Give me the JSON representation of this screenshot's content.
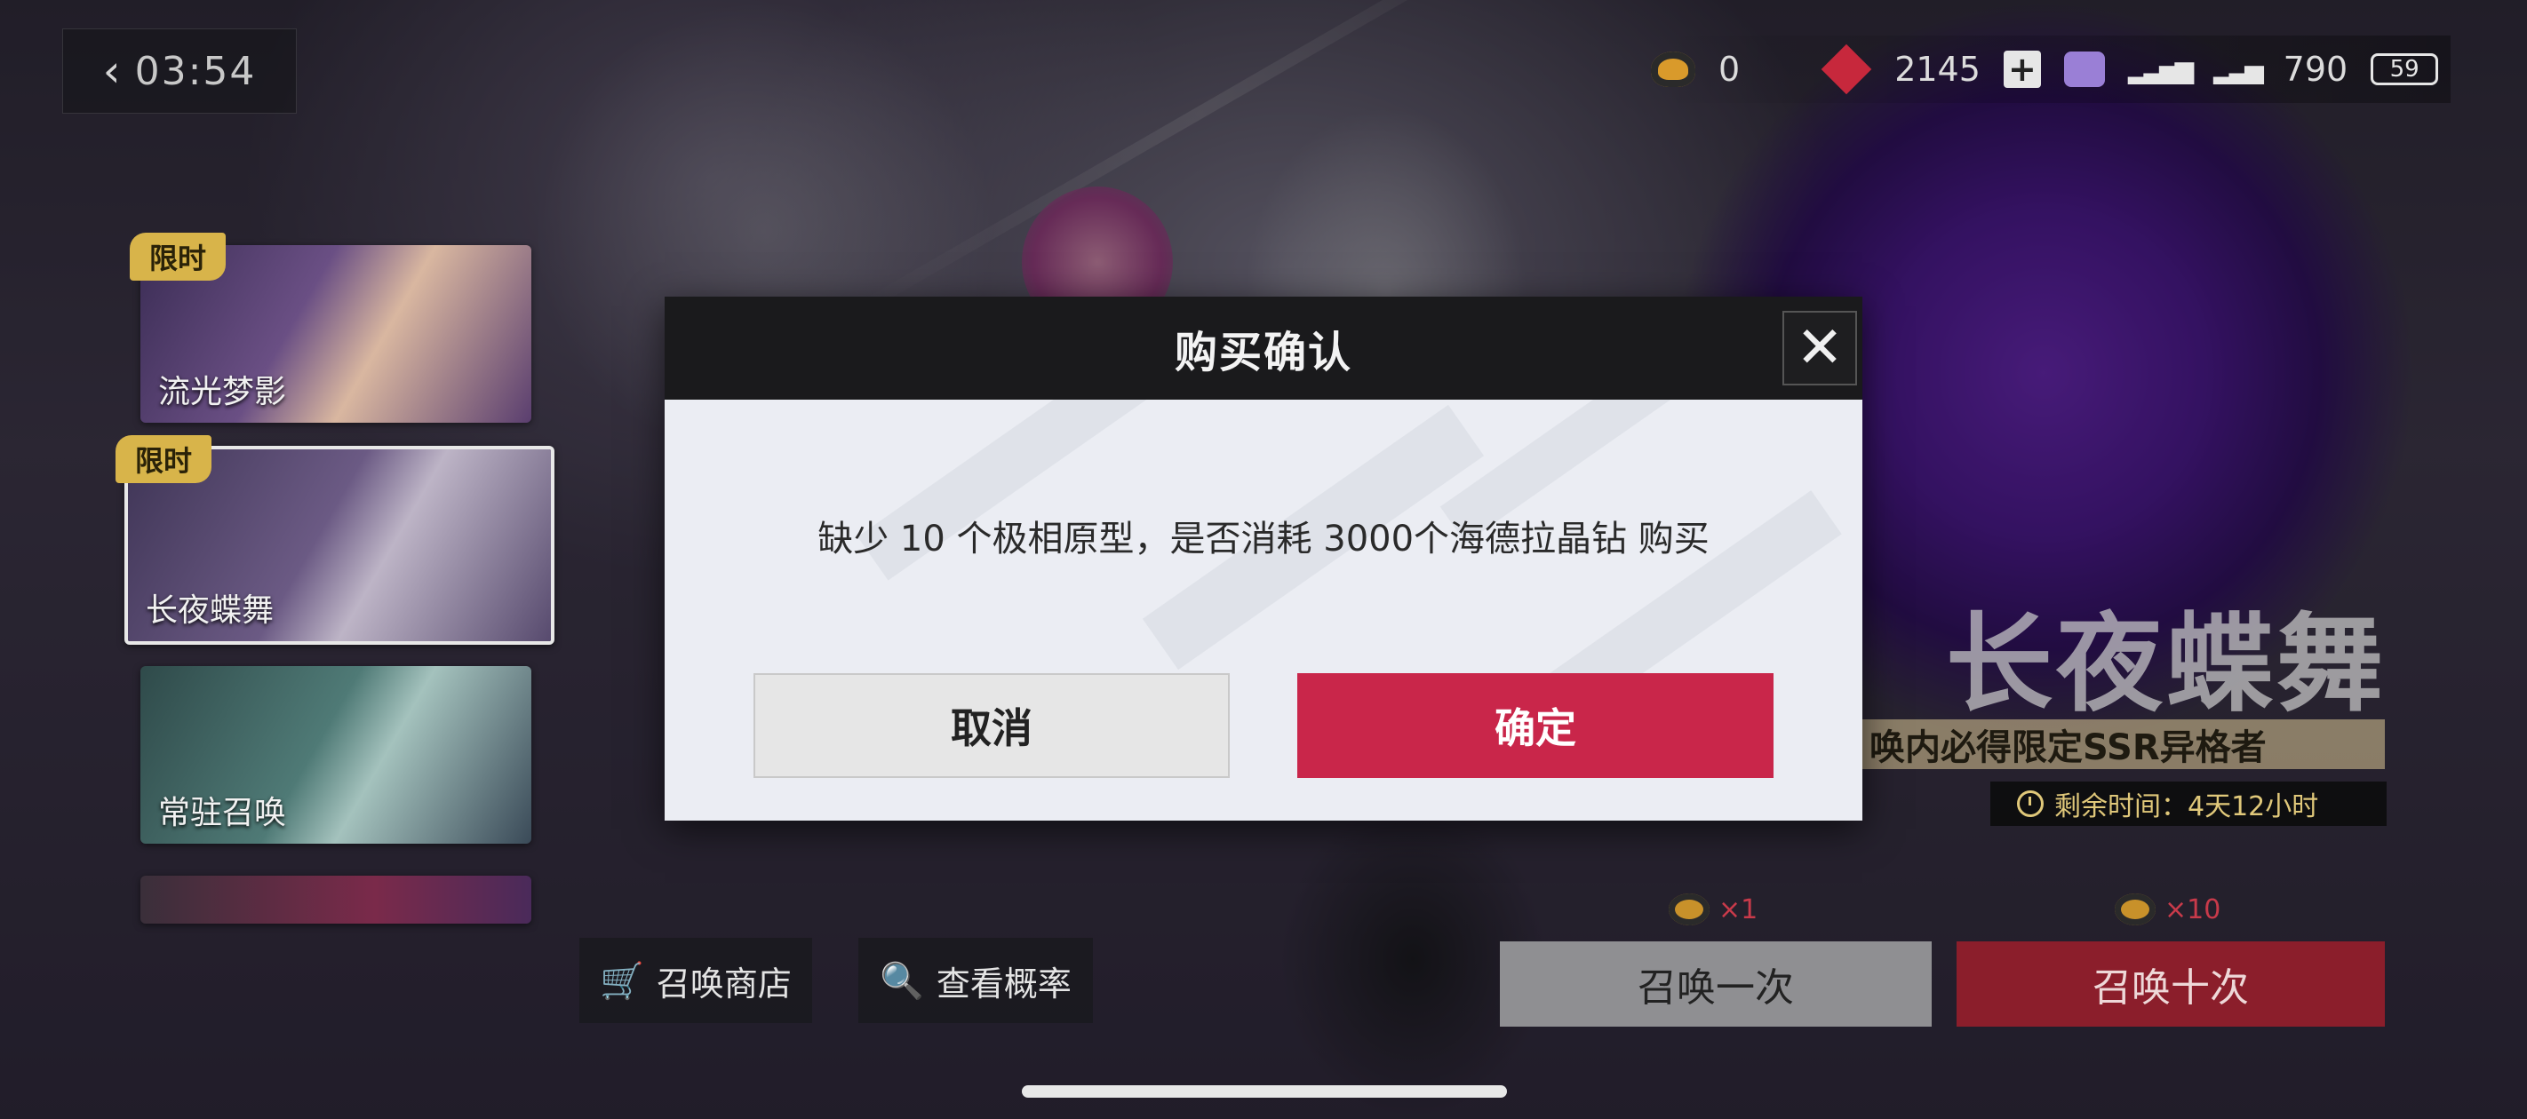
{
  "status": {
    "time": "03:54"
  },
  "currency": {
    "ticket_count": "0",
    "gem_count": "2145",
    "crystal_count": "790",
    "battery": "59"
  },
  "banners": [
    {
      "label": "流光梦影",
      "badge": "限时"
    },
    {
      "label": "长夜蝶舞",
      "badge": "限时"
    },
    {
      "label": "常驻召唤"
    },
    {
      "label": ""
    }
  ],
  "featured": {
    "title": "长夜蝶舞",
    "guarantee": "唤内必得限定SSR异格者",
    "time_left": "剩余时间：4天12小时"
  },
  "bottom": {
    "shop_label": "召唤商店",
    "rate_label": "查看概率",
    "summon_once": "召唤一次",
    "summon_ten": "召唤十次",
    "cost_once": "×1",
    "cost_ten": "×10"
  },
  "dialog": {
    "title": "购买确认",
    "message": "缺少 10 个极相原型，是否消耗 3000个海德拉晶钻 购买",
    "cancel": "取消",
    "confirm": "确定"
  },
  "colors": {
    "accent_red": "#c9264a",
    "gold": "#d8b44a"
  }
}
